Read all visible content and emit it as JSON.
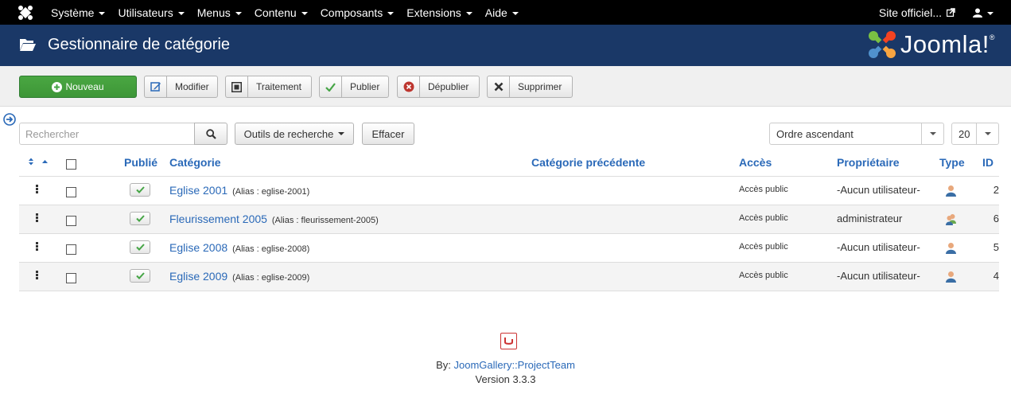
{
  "nav": {
    "menus": [
      "Système",
      "Utilisateurs",
      "Menus",
      "Contenu",
      "Composants",
      "Extensions",
      "Aide"
    ],
    "site_label": "Site officiel..."
  },
  "header": {
    "title": "Gestionnaire de catégorie",
    "brand": "Joomla!"
  },
  "toolbar": {
    "new_label": "Nouveau",
    "edit_label": "Modifier",
    "batch_label": "Traitement",
    "publish_label": "Publier",
    "unpublish_label": "Dépublier",
    "delete_label": "Supprimer"
  },
  "filters": {
    "search_placeholder": "Rechercher",
    "search_tools_label": "Outils de recherche",
    "clear_label": "Effacer",
    "ordering_value": "Ordre ascendant",
    "limit_value": "20"
  },
  "table": {
    "headers": {
      "published": "Publié",
      "category": "Catégorie",
      "parent": "Catégorie précédente",
      "access": "Accès",
      "owner": "Propriétaire",
      "type": "Type",
      "id": "ID"
    },
    "rows": [
      {
        "title": "Eglise 2001",
        "alias": "(Alias : eglise-2001)",
        "access": "Accès public",
        "owner": "-Aucun utilisateur-",
        "id": "2"
      },
      {
        "title": "Fleurissement 2005",
        "alias": "(Alias : fleurissement-2005)",
        "access": "Accès public",
        "owner": "administrateur",
        "id": "6"
      },
      {
        "title": "Eglise 2008",
        "alias": "(Alias : eglise-2008)",
        "access": "Accès public",
        "owner": "-Aucun utilisateur-",
        "id": "5"
      },
      {
        "title": "Eglise 2009",
        "alias": "(Alias : eglise-2009)",
        "access": "Accès public",
        "owner": "-Aucun utilisateur-",
        "id": "4"
      }
    ]
  },
  "footer": {
    "by_prefix": "By:",
    "by_link": "JoomGallery::ProjectTeam",
    "version": "Version 3.3.3"
  },
  "colors": {
    "topbar": "#000000",
    "header": "#1a3867",
    "primary_button": "#46a546",
    "link": "#2a69b8",
    "publish_check": "#46a546"
  }
}
